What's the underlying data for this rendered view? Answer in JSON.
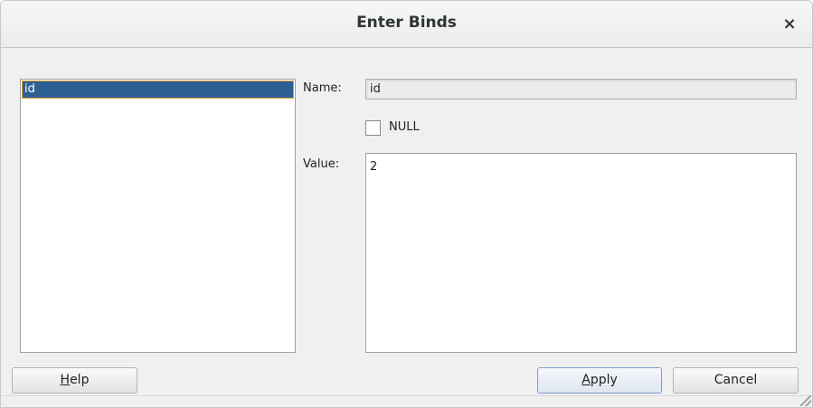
{
  "dialog": {
    "title": "Enter Binds",
    "close_icon": "×"
  },
  "binds_list": {
    "items": [
      {
        "label": "id",
        "selected": true
      }
    ]
  },
  "form": {
    "name_label": "Name:",
    "name_value": "id",
    "null_label": "NULL",
    "null_checked": false,
    "value_label": "Value:",
    "value_text": "2"
  },
  "buttons": {
    "help": {
      "mnemonic": "H",
      "rest": "elp"
    },
    "apply": {
      "mnemonic": "A",
      "rest": "pply"
    },
    "cancel": "Cancel"
  },
  "colors": {
    "selection": "#2d5f92",
    "selection_border": "#e0a030"
  }
}
